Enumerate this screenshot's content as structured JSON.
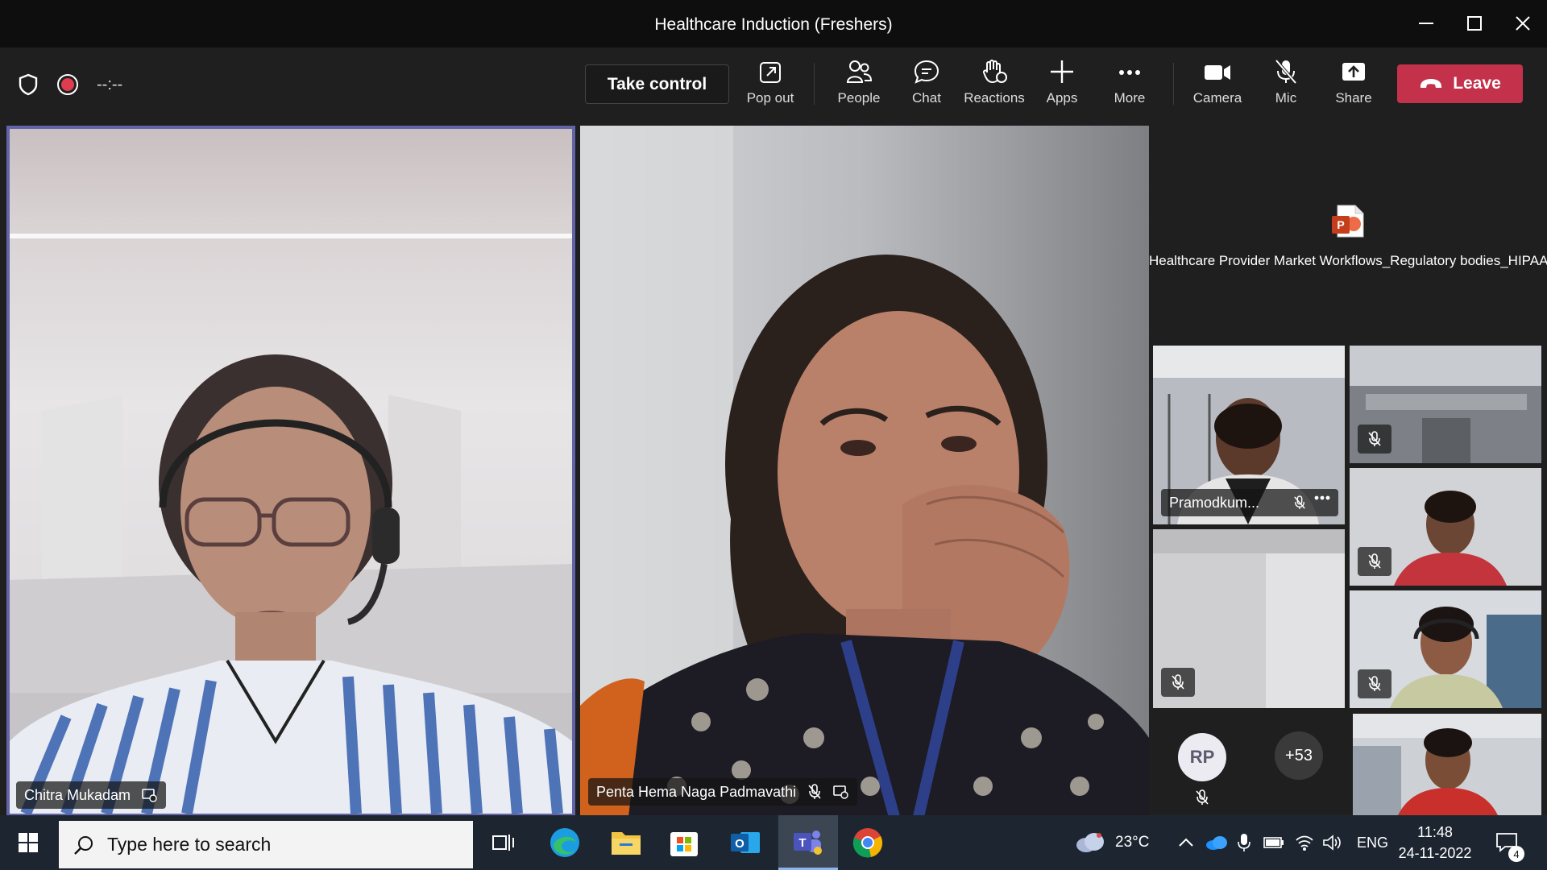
{
  "window": {
    "title": "Healthcare Induction (Freshers)"
  },
  "toolbar": {
    "timer": "--:--",
    "take_control": "Take control",
    "buttons": [
      {
        "label": "Pop out",
        "icon": "popout-icon"
      },
      {
        "label": "People",
        "icon": "people-icon"
      },
      {
        "label": "Chat",
        "icon": "chat-icon"
      },
      {
        "label": "Reactions",
        "icon": "reactions-icon"
      },
      {
        "label": "Apps",
        "icon": "plus-icon"
      },
      {
        "label": "More",
        "icon": "more-icon"
      },
      {
        "label": "Camera",
        "icon": "camera-icon"
      },
      {
        "label": "Mic",
        "icon": "mic-off-icon"
      },
      {
        "label": "Share",
        "icon": "share-icon"
      }
    ],
    "leave": "Leave",
    "leave_color": "#c4314b"
  },
  "participants": {
    "main_left": {
      "name": "Chitra Mukadam"
    },
    "main_center": {
      "name": "Penta Hema Naga Padmavathi"
    },
    "shared_file": {
      "name": "Healthcare Provider Market Workflows_Regulatory bodies_HIPAA",
      "icon": "powerpoint-icon"
    },
    "small_tile_name": "Pramodkum...",
    "avatar_initials": "RP",
    "overflow_count": "+53"
  },
  "taskbar": {
    "search_placeholder": "Type here to search",
    "weather": "23°C",
    "language": "ENG",
    "time": "11:48",
    "date": "24-11-2022",
    "notification_count": "4"
  },
  "colors": {
    "active_speaker_border": "#6264a7",
    "titlebar_bg": "#0e0e0e",
    "toolbar_bg": "#1f1f1f",
    "taskbar_bg": "#1d2630"
  }
}
